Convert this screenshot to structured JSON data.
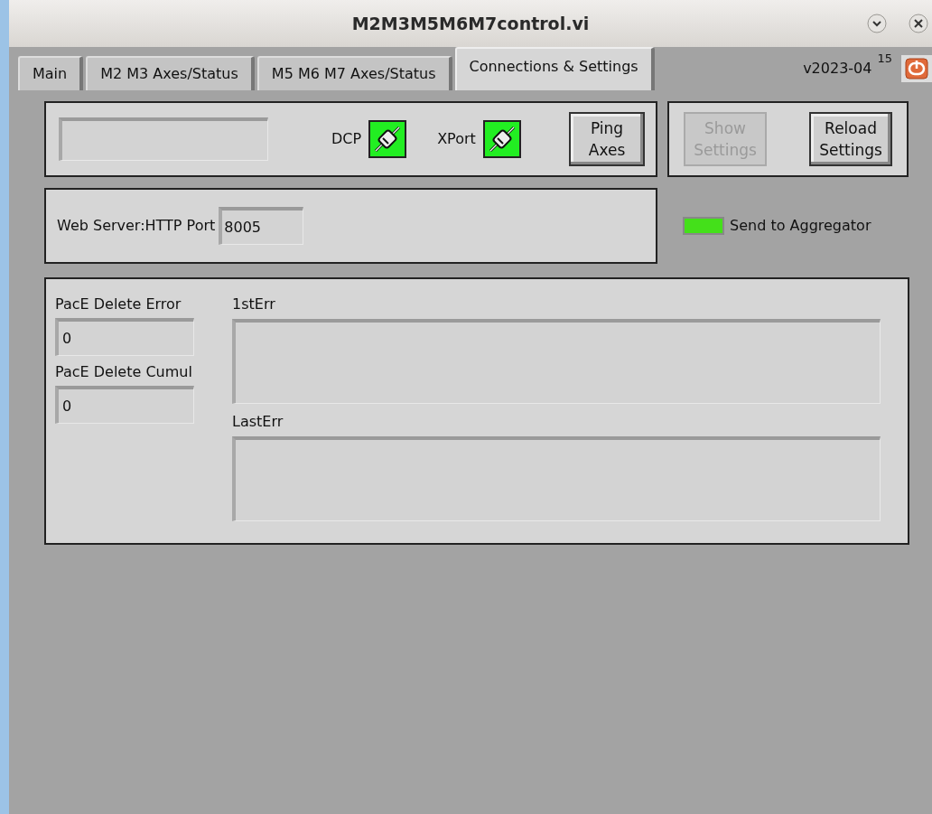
{
  "window": {
    "title": "M2M3M5M6M7control.vi"
  },
  "tabs": [
    {
      "label": "Main",
      "selected": false
    },
    {
      "label": "M2 M3 Axes/Status",
      "selected": false
    },
    {
      "label": "M5 M6 M7 Axes/Status",
      "selected": false
    },
    {
      "label": "Connections & Settings",
      "selected": true
    }
  ],
  "version": "v2023-04",
  "version_number": "15",
  "indicators": [
    {
      "label": "DCP",
      "on": true
    },
    {
      "label": "XPort",
      "on": true
    }
  ],
  "ping_button": {
    "label": "Ping Axes"
  },
  "settings_buttons": [
    {
      "label": "Show Settings",
      "disabled": true
    },
    {
      "label": "Reload Settings",
      "disabled": false
    }
  ],
  "web_server": {
    "label": "Web Server:HTTP Port",
    "value": "8005"
  },
  "send_to_aggregator": {
    "label": "Send to Aggregator",
    "on": true
  },
  "counters": [
    {
      "label": "PacE Delete Error",
      "value": "0"
    },
    {
      "label": "PacE Delete Cumul",
      "value": "0"
    }
  ],
  "error_fields": [
    {
      "label": "1stErr"
    },
    {
      "label": "LastErr"
    }
  ]
}
